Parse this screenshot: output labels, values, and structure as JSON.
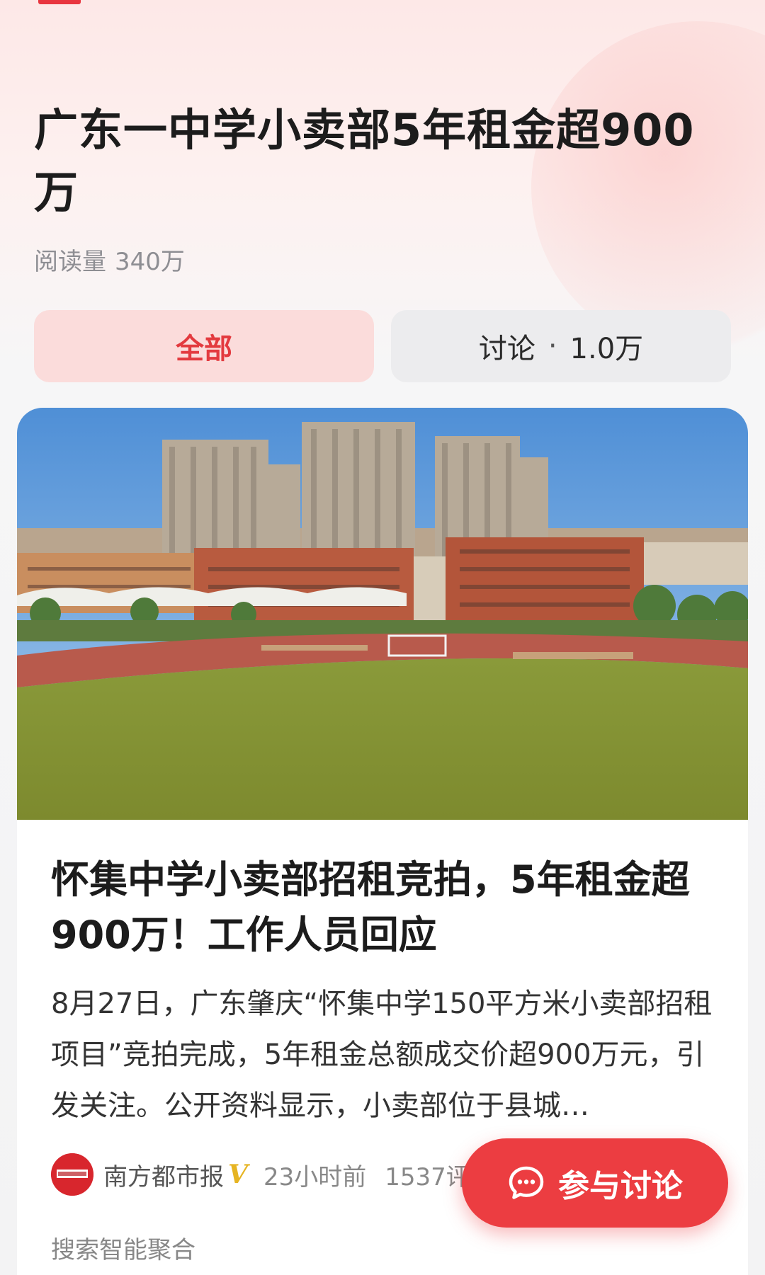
{
  "topic": {
    "title": "广东一中学小卖部5年租金超900万",
    "read_label": "阅读量",
    "read_count": "340万"
  },
  "tabs": {
    "all_label": "全部",
    "discuss_label": "讨论",
    "discuss_separator": "·",
    "discuss_count": "1.0万"
  },
  "card": {
    "image_icon": "school-building-photo",
    "title": "怀集中学小卖部招租竞拍，5年租金超900万！工作人员回应",
    "summary": "8月27日，广东肇庆“怀集中学150平方米小卖部招租项目”竞拍完成，5年租金总额成交价超900万元，引发关注。公开资料显示，小卖部位于县城…",
    "source_name": "南方都市报",
    "verified_mark": "V",
    "time": "23小时前",
    "count_visible": "1537评",
    "aggregate_label": "搜索智能聚合"
  },
  "fab": {
    "label": "参与讨论",
    "icon": "chat-bubble-icon"
  },
  "colors": {
    "accent": "#ec3d41",
    "tab_active_bg": "#fbdcdb",
    "tab_inactive_bg": "#ececee",
    "verified": "#e6b422"
  }
}
